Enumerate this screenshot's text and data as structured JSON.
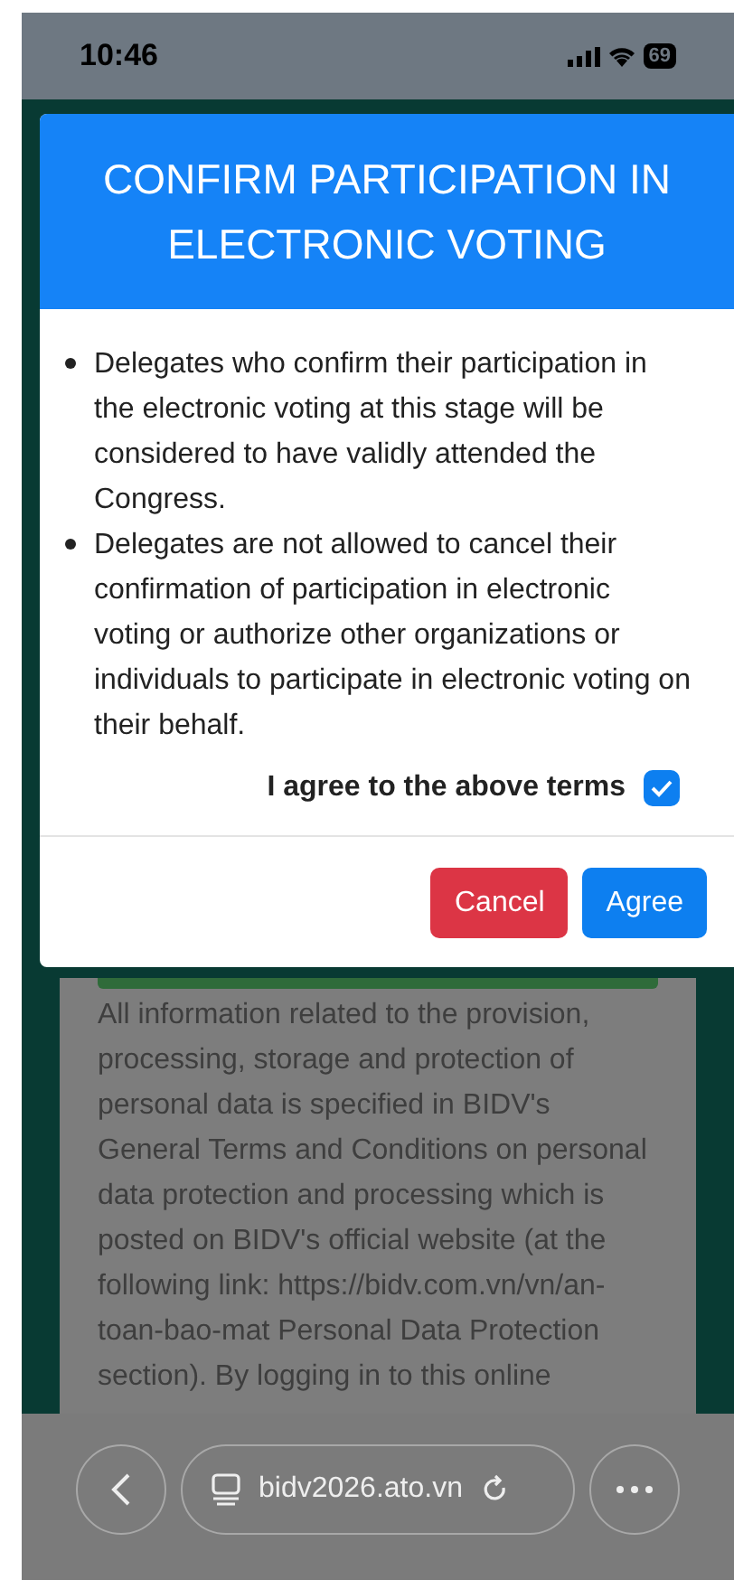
{
  "status_bar": {
    "time": "10:46",
    "battery": "69"
  },
  "dialog": {
    "title": "CONFIRM PARTICIPATION IN ELECTRONIC VOTING",
    "bullets": [
      "Delegates who confirm their participation in the electronic voting at this stage will be considered to have validly attended the Congress.",
      "Delegates are not allowed to cancel their confirmation of participation in electronic voting or authorize other organizations or individuals to participate in electronic voting on their behalf."
    ],
    "agree_checkbox": {
      "label": "I agree to the above terms",
      "checked": true
    },
    "buttons": [
      {
        "label": "Cancel",
        "kind": "cancel"
      },
      {
        "label": "Agree",
        "kind": "primary"
      }
    ]
  },
  "background_text": "All information related to the provision, processing, storage and protection of personal data is specified in BIDV's General Terms and Conditions on personal data protection and processing which is posted on BIDV's official website (at the following link: https://bidv.com.vn/vn/an-toan-bao-mat Personal Data Protection section). By logging in to this online",
  "browser_bar": {
    "url": "bidv2026.ato.vn"
  }
}
